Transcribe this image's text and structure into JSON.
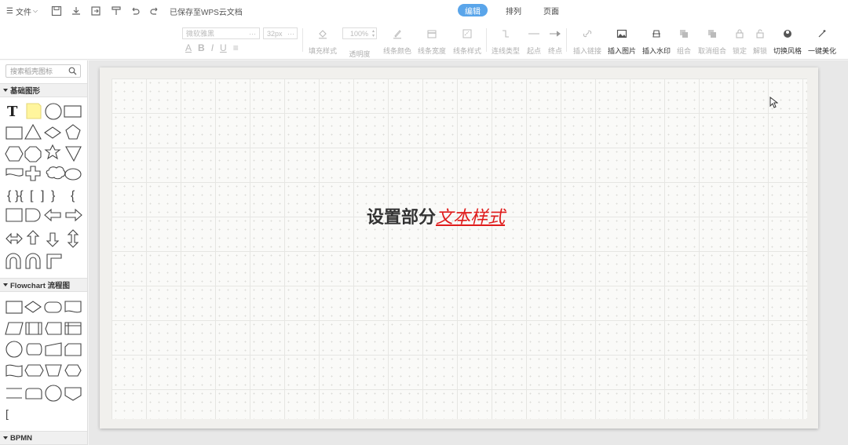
{
  "topbar": {
    "menu_label": "文件",
    "save_status": "已保存至WPS云文档",
    "tabs": [
      {
        "label": "编辑",
        "active": true
      },
      {
        "label": "排列",
        "active": false
      },
      {
        "label": "页面",
        "active": false
      }
    ]
  },
  "toolbar": {
    "font_family": "微软雅黑",
    "font_size": "32px",
    "opacity": "100%",
    "tools": [
      {
        "label": "填充样式",
        "icon": "fill-icon"
      },
      {
        "label": "透明度",
        "icon": "opacity-icon"
      },
      {
        "label": "线条颜色",
        "icon": "line-color-icon"
      },
      {
        "label": "线条宽度",
        "icon": "line-width-icon"
      },
      {
        "label": "线条样式",
        "icon": "line-style-icon"
      },
      {
        "label": "连线类型",
        "icon": "connector-type-icon"
      },
      {
        "label": "起点",
        "icon": "line-start-icon"
      },
      {
        "label": "终点",
        "icon": "line-end-icon"
      },
      {
        "label": "插入链接",
        "icon": "link-icon"
      },
      {
        "label": "插入图片",
        "icon": "image-icon"
      },
      {
        "label": "插入水印",
        "icon": "watermark-icon"
      },
      {
        "label": "组合",
        "icon": "group-icon"
      },
      {
        "label": "取消组合",
        "icon": "ungroup-icon"
      },
      {
        "label": "锁定",
        "icon": "lock-icon"
      },
      {
        "label": "解锁",
        "icon": "unlock-icon"
      },
      {
        "label": "切换风格",
        "icon": "theme-icon"
      },
      {
        "label": "一键美化",
        "icon": "beautify-icon"
      }
    ],
    "text_buttons": [
      "A",
      "B",
      "I",
      "U",
      "≡"
    ]
  },
  "sidebar": {
    "search_placeholder": "搜索稻壳图标",
    "sections": [
      {
        "title": "基础图形"
      },
      {
        "title": "Flowchart 流程图"
      },
      {
        "title": "BPMN"
      }
    ]
  },
  "canvas": {
    "text_plain": "设置部分",
    "text_styled": "文本样式",
    "styled_color": "#e01b1b"
  },
  "colors": {
    "accent": "#5aa5ea",
    "disabled_text": "#b0b0b0"
  }
}
